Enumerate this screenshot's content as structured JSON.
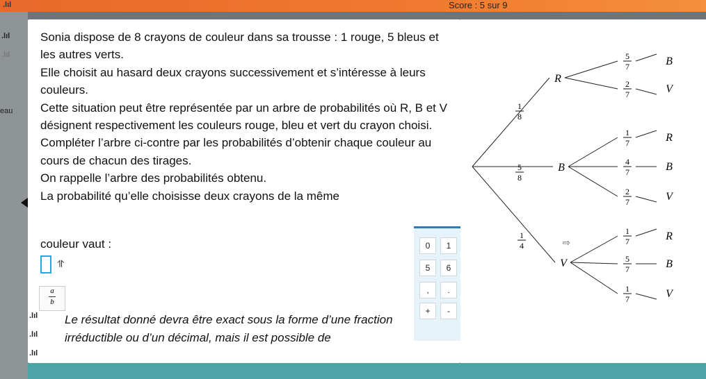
{
  "topbar": {
    "score_text": "Score : 5 sur 9",
    "signal_glyph": ".lıl"
  },
  "left_strip": {
    "labels": [
      ".lıl",
      ".lıl",
      "eau",
      ".lıl",
      ".lıl",
      ".lıl"
    ]
  },
  "question": {
    "paragraphs": [
      "Sonia dispose de 8 crayons de couleur dans sa trousse : 1 rouge, 5 bleus et les autres verts.",
      "Elle choisit au hasard deux crayons successivement et s’intéresse à leurs couleurs.",
      "Cette situation peut être représentée par un arbre de probabilités où R, B et V désignent respectivement les couleurs rouge, bleu et vert du crayon choisi.",
      "Compléter l’arbre ci-contre par les probabilités d’obtenir chaque couleur au cours de chacun des tirages.",
      "On rappelle l’arbre des probabilités obtenu.",
      "La probabilité qu’elle choisisse deux crayons de la même"
    ],
    "answer_label": "couleur vaut :",
    "caret": "⥣",
    "note": "Le résultat donné devra être exact sous la forme d’une fraction irréductible ou d’un décimal, mais il est possible de"
  },
  "fraction_button": {
    "num": "a",
    "den": "b"
  },
  "keypad": {
    "keys": [
      "0",
      "1",
      "5",
      "6",
      ",",
      ".",
      "+",
      "-"
    ]
  },
  "tree": {
    "first": [
      {
        "label": "R",
        "num": "1",
        "den": "8",
        "second": [
          {
            "label": "B",
            "num": "5",
            "den": "7"
          },
          {
            "label": "V",
            "num": "2",
            "den": "7"
          }
        ]
      },
      {
        "label": "B",
        "num": "5",
        "den": "8",
        "second": [
          {
            "label": "R",
            "num": "1",
            "den": "7"
          },
          {
            "label": "B",
            "num": "4",
            "den": "7"
          },
          {
            "label": "V",
            "num": "2",
            "den": "7"
          }
        ]
      },
      {
        "label": "V",
        "num": "1",
        "den": "4",
        "second": [
          {
            "label": "R",
            "num": "1",
            "den": "7"
          },
          {
            "label": "B",
            "num": "5",
            "den": "7"
          },
          {
            "label": "V",
            "num": "1",
            "den": "7"
          }
        ]
      }
    ]
  },
  "colors": {
    "accent": "#2b7db5",
    "topbar": "#f07a2f",
    "bottombar": "#4da4a6"
  }
}
